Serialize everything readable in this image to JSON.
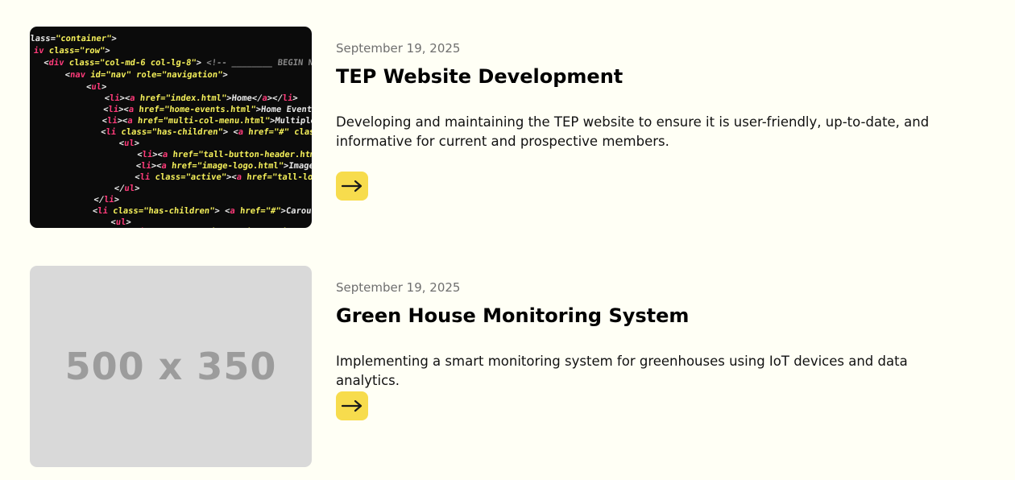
{
  "posts": [
    {
      "date": "September 19, 2025",
      "title": "TEP Website Development",
      "description": "Developing and maintaining the TEP website to ensure it is user-friendly, up-to-date, and informative for current and prospective members.",
      "image": "code-screenshot",
      "arrow_icon": "arrow-right-icon"
    },
    {
      "date": "September 19, 2025",
      "title": "Green House Monitoring System",
      "description": "Implementing a smart monitoring system for greenhouses using IoT devices and data analytics.",
      "image": "placeholder",
      "placeholder_text": "500 x 350",
      "arrow_icon": "arrow-right-icon"
    }
  ],
  "colors": {
    "background": "#fffff5",
    "button": "#f7dc4d",
    "placeholder_bg": "#d9d9d9",
    "placeholder_text": "#9c9c9c",
    "date": "#6f6f6f"
  }
}
